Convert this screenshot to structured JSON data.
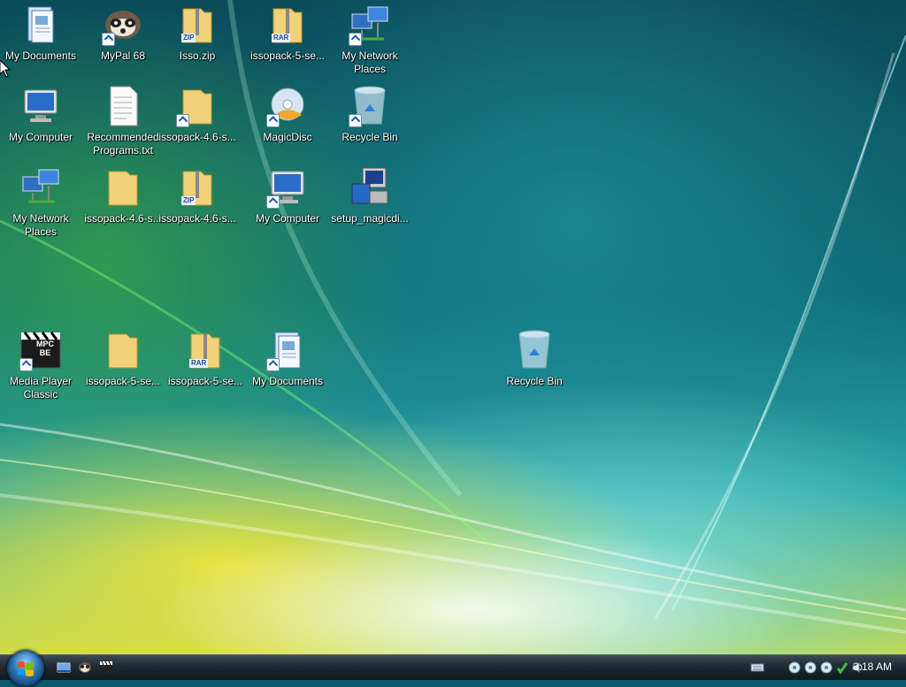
{
  "desktop_icons": [
    {
      "label": "My Documents",
      "icon": "my-documents-icon"
    },
    {
      "label": "MyPal 68",
      "icon": "mypal-icon"
    },
    {
      "label": "Isso.zip",
      "icon": "zip-folder-icon",
      "tag": "ZIP"
    },
    {
      "label": "issopack-5-se...",
      "icon": "rar-folder-icon",
      "tag": "RAR"
    },
    {
      "label": "My Network Places",
      "icon": "network-icon"
    },
    {
      "label": "My Computer",
      "icon": "computer-icon"
    },
    {
      "label": "Recommended Programs.txt",
      "icon": "text-file-icon"
    },
    {
      "label": "issopack-4.6-s...",
      "icon": "folder-shortcut-icon"
    },
    {
      "label": "MagicDisc",
      "icon": "magicdisc-icon"
    },
    {
      "label": "Recycle Bin",
      "icon": "recycle-bin-icon"
    },
    {
      "label": "My Network Places",
      "icon": "network-icon"
    },
    {
      "label": "issopack-4.6-s...",
      "icon": "folder-icon"
    },
    {
      "label": "issopack-4.6-s...",
      "icon": "zip-folder-icon",
      "tag": "ZIP"
    },
    {
      "label": "My Computer",
      "icon": "computer-icon"
    },
    {
      "label": "setup_magicdi...",
      "icon": "installer-icon"
    },
    {
      "label": "Media Player Classic",
      "icon": "mpc-be-icon",
      "tag": "MPC BE"
    },
    {
      "label": "issopack-5-se...",
      "icon": "folder-icon"
    },
    {
      "label": "issopack-5-se...",
      "icon": "rar-folder-icon",
      "tag": "RAR"
    },
    {
      "label": "My Documents",
      "icon": "my-documents-icon"
    },
    {
      "label": "Recycle Bin",
      "icon": "recycle-bin-icon"
    }
  ],
  "taskbar": {
    "start_icon": "windows-start-orb-icon",
    "quick_launch": [
      "show-desktop-icon",
      "mypal-icon",
      "mpc-be-icon"
    ],
    "tray_icons": [
      "keyboard-icon",
      "network-icon",
      "network-icon",
      "network-icon",
      "security-icon",
      "volume-icon"
    ],
    "clock": "3:18 AM"
  }
}
